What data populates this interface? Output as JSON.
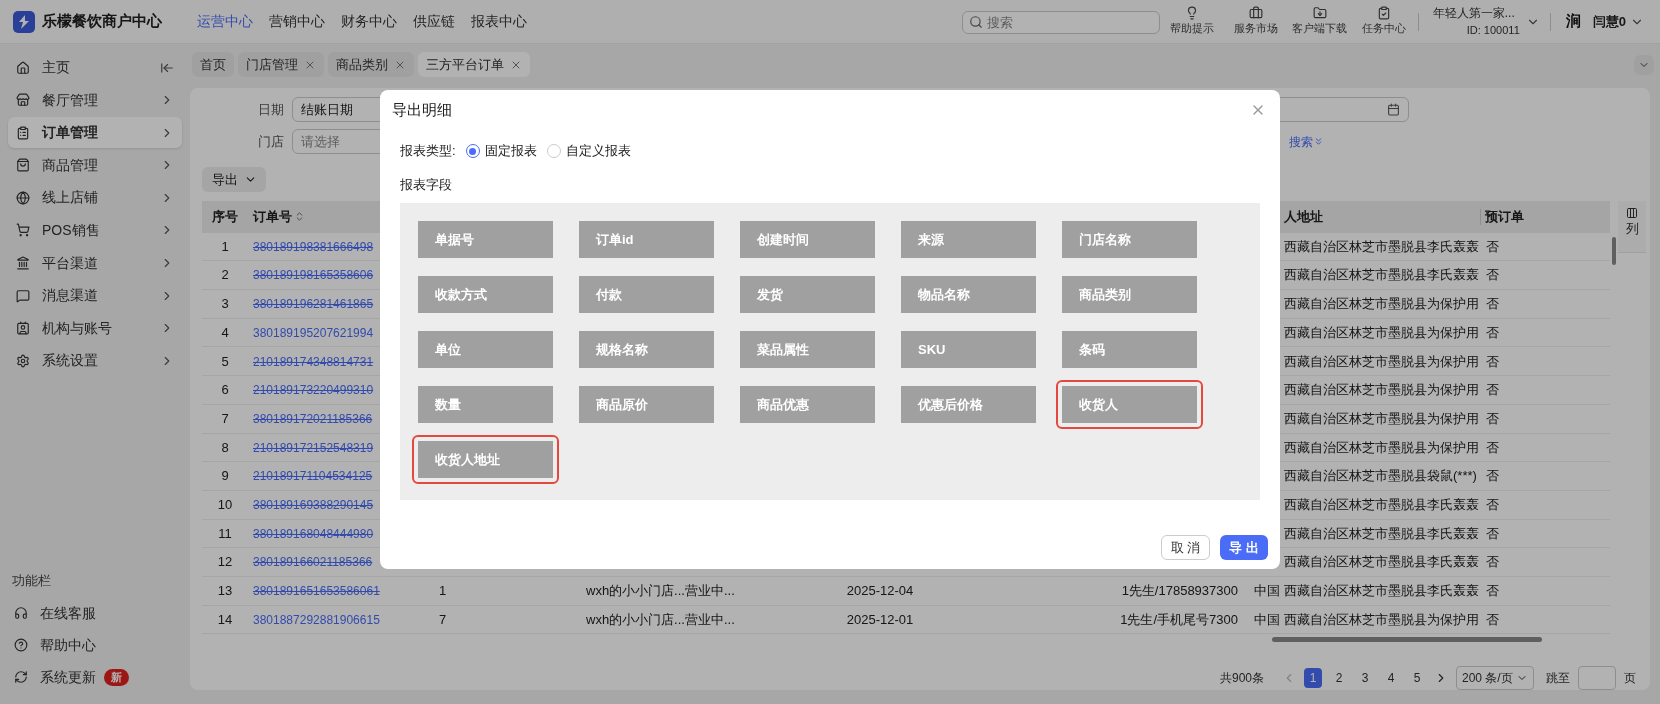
{
  "app": {
    "title": "乐檬餐饮商户中心"
  },
  "top_nav": [
    {
      "label": "运营中心",
      "selected": true
    },
    {
      "label": "营销中心",
      "selected": false
    },
    {
      "label": "财务中心",
      "selected": false
    },
    {
      "label": "供应链",
      "selected": false
    },
    {
      "label": "报表中心",
      "selected": false
    }
  ],
  "search": {
    "placeholder": "搜索"
  },
  "tools": [
    {
      "label": "帮助提示"
    },
    {
      "label": "服务市场"
    },
    {
      "label": "客户端下载"
    },
    {
      "label": "任务中心"
    }
  ],
  "account": {
    "name": "年轻人第一家...",
    "id": "ID: 100011"
  },
  "user": {
    "logo": "涧",
    "name": "闫慧0"
  },
  "sidebar": {
    "items": [
      {
        "label": "主页",
        "selected": false
      },
      {
        "label": "餐厅管理",
        "selected": false
      },
      {
        "label": "订单管理",
        "selected": true
      },
      {
        "label": "商品管理",
        "selected": false
      },
      {
        "label": "线上店铺",
        "selected": false
      },
      {
        "label": "POS销售",
        "selected": false
      },
      {
        "label": "平台渠道",
        "selected": false
      },
      {
        "label": "消息渠道",
        "selected": false
      },
      {
        "label": "机构与账号",
        "selected": false
      },
      {
        "label": "系统设置",
        "selected": false
      }
    ],
    "function_bar": {
      "title": "功能栏",
      "items": [
        {
          "label": "在线客服"
        },
        {
          "label": "帮助中心"
        },
        {
          "label": "系统更新",
          "badge": "新"
        }
      ]
    }
  },
  "tabs": [
    {
      "label": "首页",
      "selected": false,
      "closable": false
    },
    {
      "label": "门店管理",
      "selected": false,
      "closable": true
    },
    {
      "label": "商品类别",
      "selected": false,
      "closable": true
    },
    {
      "label": "三方平台订单",
      "selected": true,
      "closable": true
    }
  ],
  "filters": {
    "date": {
      "label": "日期",
      "value": "结账日期"
    },
    "store": {
      "label": "门店",
      "placeholder": "请选择"
    },
    "search_link": "搜索"
  },
  "export_button": "导出",
  "table": {
    "columns": [
      "序号",
      "订单号",
      "人地址",
      "预订单"
    ],
    "rows": [
      {
        "index": "1",
        "order_no": "380189198381666498",
        "cancelled": true,
        "address": "西藏自治区林芝市墨脱县李氏轰轰",
        "preorder": "否"
      },
      {
        "index": "2",
        "order_no": "380189198165358606",
        "cancelled": true,
        "address": "西藏自治区林芝市墨脱县李氏轰轰",
        "preorder": "否"
      },
      {
        "index": "3",
        "order_no": "380189196281461865",
        "cancelled": true,
        "address": "西藏自治区林芝市墨脱县为保护用",
        "preorder": "否"
      },
      {
        "index": "4",
        "order_no": "380189195207621994",
        "cancelled": false,
        "address": "西藏自治区林芝市墨脱县为保护用",
        "preorder": "否"
      },
      {
        "index": "5",
        "order_no": "210189174348814731",
        "cancelled": true,
        "address": "西藏自治区林芝市墨脱县为保护用",
        "preorder": "否"
      },
      {
        "index": "6",
        "order_no": "210189173220499310",
        "cancelled": true,
        "address": "西藏自治区林芝市墨脱县为保护用",
        "preorder": "否"
      },
      {
        "index": "7",
        "order_no": "380189172021185366",
        "cancelled": true,
        "address": "西藏自治区林芝市墨脱县为保护用",
        "preorder": "否"
      },
      {
        "index": "8",
        "order_no": "210189172152548319",
        "cancelled": true,
        "address": "西藏自治区林芝市墨脱县为保护用",
        "preorder": "否"
      },
      {
        "index": "9",
        "order_no": "210189171104534125",
        "cancelled": true,
        "address": "西藏自治区林芝市墨脱县袋鼠(***)",
        "preorder": "否"
      },
      {
        "index": "10",
        "order_no": "380189169388290145",
        "cancelled": true,
        "address": "西藏自治区林芝市墨脱县李氏轰轰",
        "preorder": "否"
      },
      {
        "index": "11",
        "order_no": "380189168048444980",
        "cancelled": true,
        "address": "西藏自治区林芝市墨脱县李氏轰轰",
        "preorder": "否"
      },
      {
        "index": "12",
        "order_no": "380189166021185366",
        "cancelled": true,
        "address": "西藏自治区林芝市墨脱县李氏轰轰",
        "preorder": "否"
      },
      {
        "index": "13",
        "order_no": "3801891651653586061",
        "cancelled": true,
        "column_3": "1",
        "column_4": "wxh的小小门店...营业中...",
        "column_5": "2025-12-04",
        "column_6": "1先生/17858937300",
        "country": "中国",
        "address": "西藏自治区林芝市墨脱县李氏轰轰",
        "preorder": "否"
      },
      {
        "index": "14",
        "order_no": "3801887292881906615",
        "cancelled": false,
        "column_3": "7",
        "column_4": "wxh的小小门店...营业中...",
        "column_5": "2025-12-01",
        "column_6": "1先生/手机尾号7300",
        "country": "中国",
        "address": "西藏自治区林芝市墨脱县为保护用",
        "preorder": "否"
      }
    ]
  },
  "column_settings": "列",
  "pagination": {
    "total": "共900条",
    "pages": [
      {
        "label": "1",
        "selected": true
      },
      {
        "label": "2",
        "selected": false
      },
      {
        "label": "3",
        "selected": false
      },
      {
        "label": "4",
        "selected": false
      },
      {
        "label": "5",
        "selected": false
      }
    ],
    "page_size": "200 条/页",
    "jump_label": "跳至",
    "page_unit": "页"
  },
  "modal": {
    "title": "导出明细",
    "report_type_label": "报表类型:",
    "report_types": [
      {
        "label": "固定报表",
        "selected": true
      },
      {
        "label": "自定义报表",
        "selected": false
      }
    ],
    "fields_label": "报表字段",
    "fields": [
      {
        "label": "单据号",
        "highlighted": false
      },
      {
        "label": "订单id",
        "highlighted": false
      },
      {
        "label": "创建时间",
        "highlighted": false
      },
      {
        "label": "来源",
        "highlighted": false
      },
      {
        "label": "门店名称",
        "highlighted": false
      },
      {
        "label": "收款方式",
        "highlighted": false
      },
      {
        "label": "付款",
        "highlighted": false
      },
      {
        "label": "发货",
        "highlighted": false
      },
      {
        "label": "物品名称",
        "highlighted": false
      },
      {
        "label": "商品类别",
        "highlighted": false
      },
      {
        "label": "单位",
        "highlighted": false
      },
      {
        "label": "规格名称",
        "highlighted": false
      },
      {
        "label": "菜品属性",
        "highlighted": false
      },
      {
        "label": "SKU",
        "highlighted": false
      },
      {
        "label": "条码",
        "highlighted": false
      },
      {
        "label": "数量",
        "highlighted": false
      },
      {
        "label": "商品原价",
        "highlighted": false
      },
      {
        "label": "商品优惠",
        "highlighted": false
      },
      {
        "label": "优惠后价格",
        "highlighted": false
      },
      {
        "label": "收货人",
        "highlighted": true
      },
      {
        "label": "收货人地址",
        "highlighted": true
      }
    ],
    "cancel": "取 消",
    "confirm": "导 出"
  }
}
